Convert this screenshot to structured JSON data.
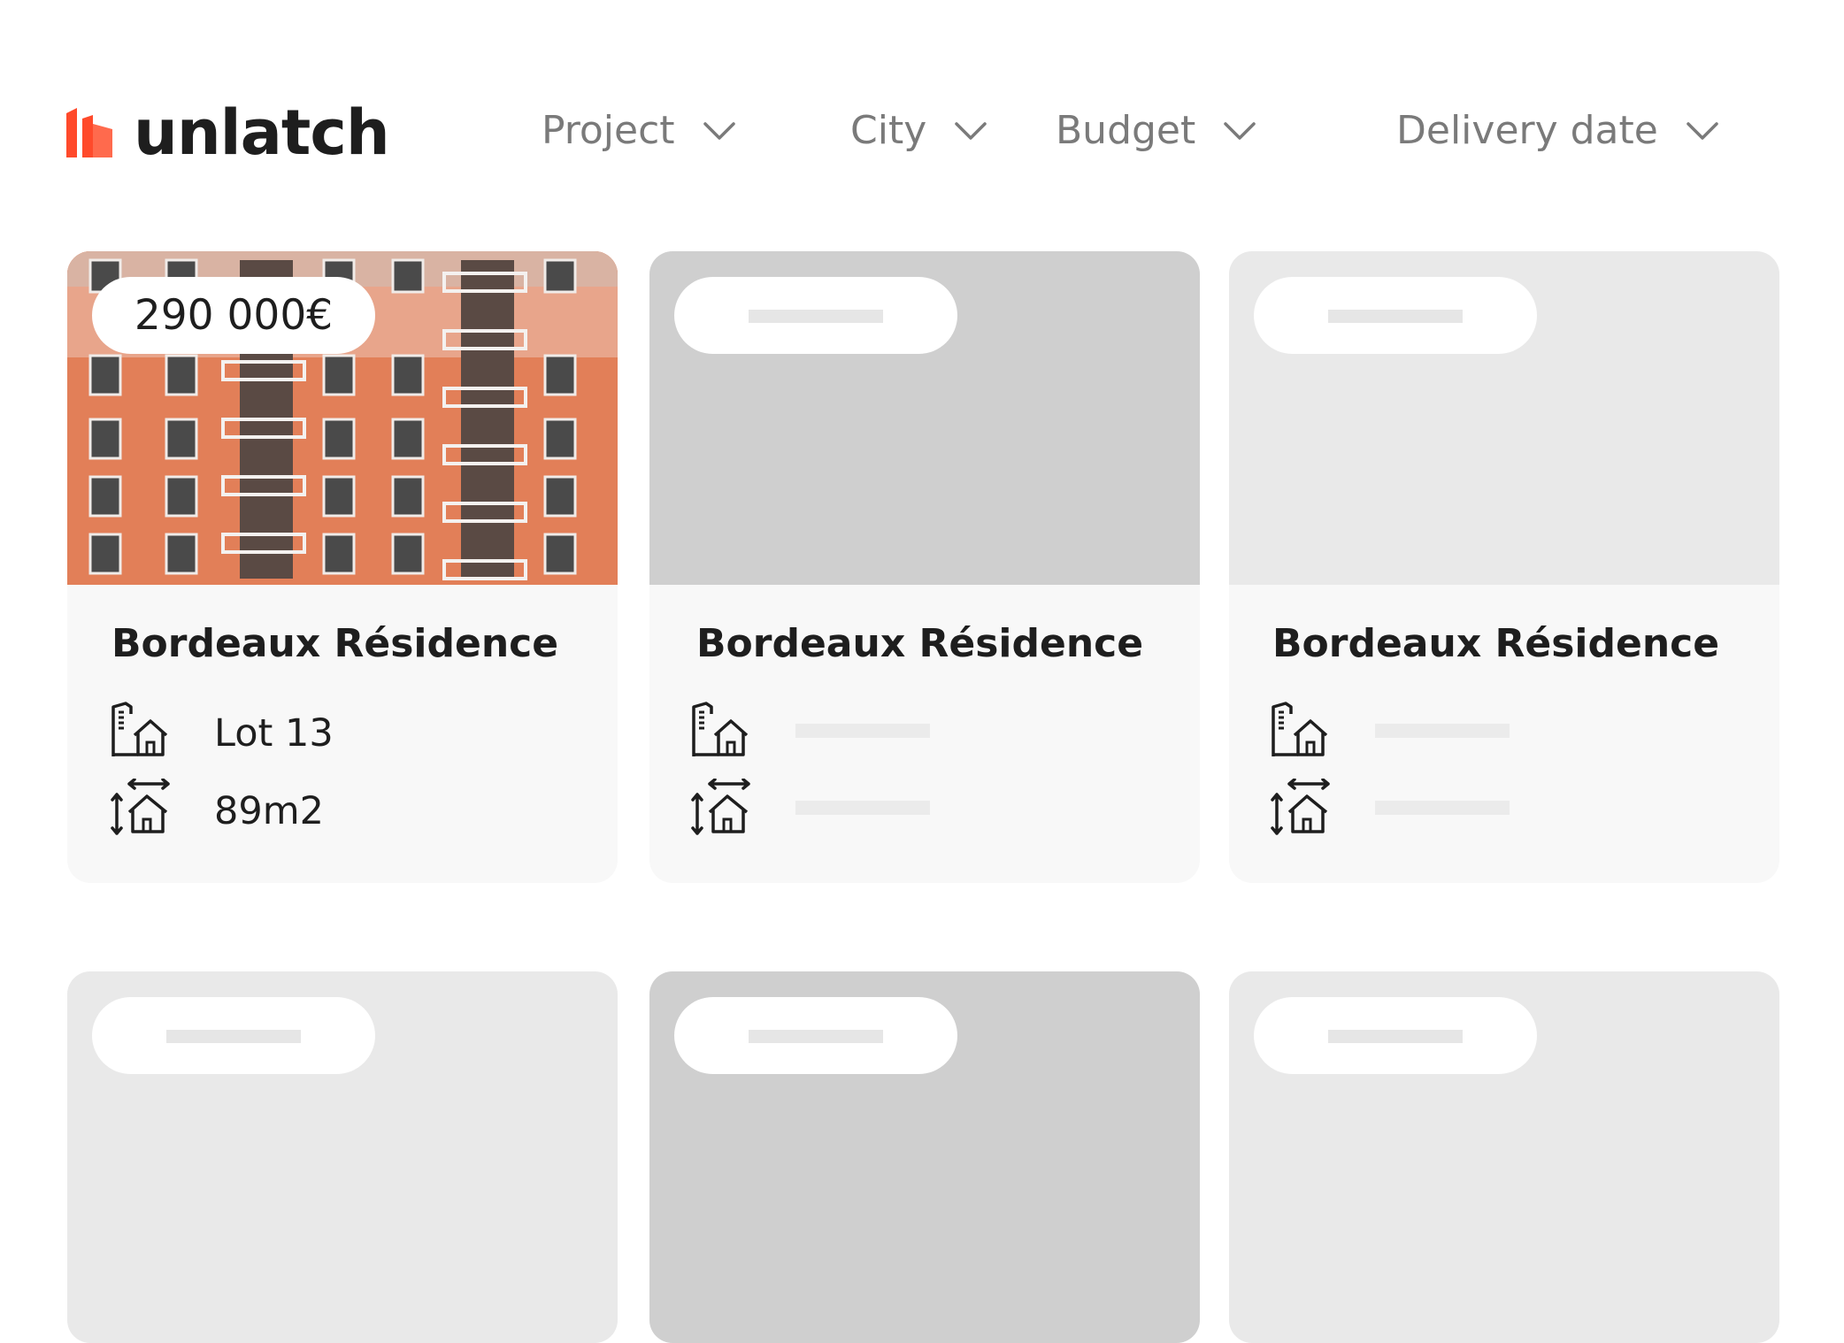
{
  "brand": {
    "name": "unlatch",
    "color": "#ff4a2b"
  },
  "filters": [
    {
      "label": "Project"
    },
    {
      "label": "City"
    },
    {
      "label": "Budget"
    },
    {
      "label": "Delivery date"
    }
  ],
  "listings": [
    {
      "price": "290 000€",
      "title": "Bordeaux Résidence",
      "lot": "Lot 13",
      "area": "89m2",
      "state": "loaded"
    },
    {
      "title": "Bordeaux Résidence",
      "state": "skeleton"
    },
    {
      "title": "Bordeaux Résidence",
      "state": "skeleton"
    },
    {
      "state": "skeleton"
    },
    {
      "state": "skeleton"
    },
    {
      "state": "skeleton"
    }
  ],
  "icons": {
    "lot": "building-house-icon",
    "area": "area-house-icon",
    "filter": "chevron-down-icon"
  },
  "colors": {
    "text": "#1e1e1e",
    "filter_text": "#7a7a7a",
    "skeleton_dark": "#cfcfcf",
    "skeleton_light": "#e9e9e9",
    "card_bg": "#f8f8f8"
  }
}
